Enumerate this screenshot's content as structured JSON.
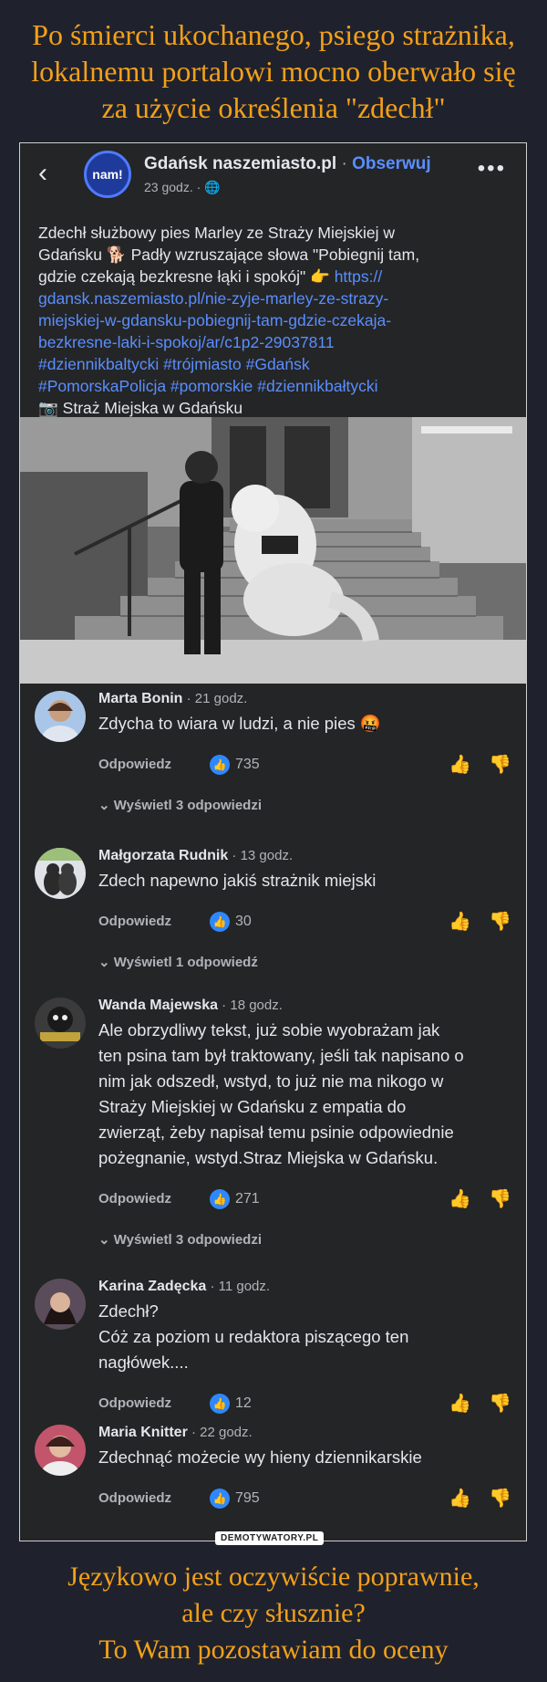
{
  "headline": [
    "Po śmierci ukochanego, psiego strażnika,",
    "lokalnemu portalowi mocno oberwało się",
    "za użycie określenia \"zdechł\""
  ],
  "post": {
    "back_icon": "chevron-left-icon",
    "logo_text": "nam!",
    "page_name": "Gdańsk naszemiasto.pl",
    "separator": " · ",
    "follow_label": "Obserwuj",
    "time": "23 godz. · ",
    "globe_icon": "globe-icon",
    "more_icon": "more-icon",
    "text_line1": "Zdechł służbowy pies Marley ze Straży Miejskiej w",
    "text_line2a": "Gdańsku ",
    "text_line2b": " Padły wzruszające słowa \"Pobiegnij tam,",
    "text_line3a": "gdzie czekają bezkresne łąki i spokój\" ",
    "text_line3link": "https://",
    "link_line1": "gdansk.naszemiasto.pl/nie-zyje-marley-ze-strazy-",
    "link_line2": "miejskiej-w-gdansku-pobiegnij-tam-gdzie-czekaja-",
    "link_line3": "bezkresne-laki-i-spokoj/ar/c1p2-29037811",
    "hashtags1": " #dziennikbaltycki #trójmiasto #Gdańsk",
    "hashtags2": "#PomorskaPolicja #pomorskie #dziennikbałtycki",
    "credit": " Straż Miejska w Gdańsku"
  },
  "comments": [
    {
      "name": "Marta Bonin",
      "time": " · 21 godz.",
      "text": [
        "Zdycha to wiara w ludzi, a nie pies 🤬"
      ],
      "reply_label": "Odpowiedz",
      "likes": "735",
      "replies": "Wyświetl 3 odpowiedzi"
    },
    {
      "name": "Małgorzata Rudnik",
      "time": " · 13 godz.",
      "text": [
        "Zdech napewno jakiś strażnik miejski"
      ],
      "reply_label": "Odpowiedz",
      "likes": "30",
      "replies": "Wyświetl 1 odpowiedź"
    },
    {
      "name": "Wanda Majewska",
      "time": " · 18 godz.",
      "text": [
        "Ale obrzydliwy tekst, już sobie wyobrażam jak",
        "ten psina tam był traktowany, jeśli tak napisano o",
        "nim jak odszedł, wstyd, to już nie ma nikogo w",
        "Straży Miejskiej w Gdańsku z empatia do",
        "zwierząt, żeby napisał temu psinie odpowiednie",
        "pożegnanie, wstyd.Straz Miejska w Gdańsku."
      ],
      "reply_label": "Odpowiedz",
      "likes": "271",
      "replies": "Wyświetl 3 odpowiedzi"
    },
    {
      "name": "Karina Zadęcka",
      "time": " · 11 godz.",
      "text": [
        "Zdechł?",
        "Cóż za poziom u redaktora piszącego ten",
        "nagłówek...."
      ],
      "reply_label": "Odpowiedz",
      "likes": "12",
      "replies": ""
    },
    {
      "name": "Maria Knitter",
      "time": " · 22 godz.",
      "text": [
        "Zdechnąć możecie wy hieny dziennikarskie"
      ],
      "reply_label": "Odpowiedz",
      "likes": "795",
      "replies": ""
    }
  ],
  "watermark": "DEMOTYWATORY.PL",
  "bottom_caption": [
    "Językowo jest oczywiście poprawnie,",
    "ale czy słusznie?",
    "To Wam pozostawiam do oceny"
  ],
  "colors": {
    "headline": "#f3a019",
    "link": "#5a8eff",
    "background": "#1f222d",
    "card": "#242526"
  }
}
